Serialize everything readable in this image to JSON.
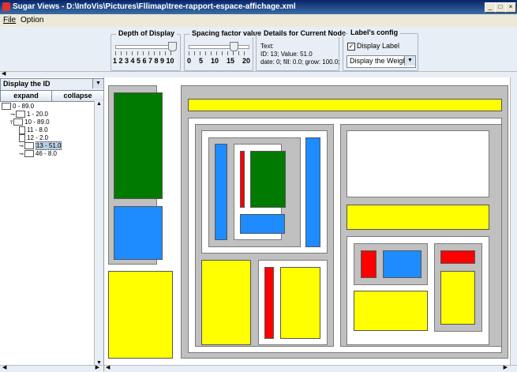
{
  "window": {
    "title": "Sugar Views - D:\\InfoVis\\Pictures\\Fllimap\\tree-rapport-espace-affichage.xml",
    "min": "_",
    "max": "□",
    "close": "×"
  },
  "menu": {
    "items": [
      {
        "label": "File"
      },
      {
        "label": "Option"
      }
    ]
  },
  "controls": {
    "depth": {
      "legend": "Depth of Display",
      "numbers": "1 2 3 4 5 6 7 8 9 10",
      "value": 10
    },
    "spacing": {
      "legend": "Spacing factor value",
      "numbers": "0    5    10    15    20",
      "value": 15
    },
    "details": {
      "legend": "Details for Current Node",
      "text": "Text:\nID: 13; Value: 51.0\ndate: 0; fill: 0.0; grow: 100.0;"
    },
    "label_config": {
      "legend": "Label's config",
      "checkbox_label": "Display Label",
      "checked": true,
      "combo_value": "Display the Weight"
    }
  },
  "sidebar": {
    "combo_value": "Display the ID",
    "expand_label": "expand",
    "collapse_label": "collapse",
    "tree": [
      {
        "label": "0 - 89.0",
        "depth": 0,
        "type": "folder"
      },
      {
        "label": "1 - 20.0",
        "depth": 1,
        "type": "folder"
      },
      {
        "label": "10 - 89.0",
        "depth": 1,
        "type": "folder"
      },
      {
        "label": "11 - 8.0",
        "depth": 2,
        "type": "doc"
      },
      {
        "label": "12 - 2.0",
        "depth": 2,
        "type": "doc"
      },
      {
        "label": "13 - 51.0",
        "depth": 2,
        "type": "folder",
        "selected": true
      },
      {
        "label": "46 - 8.0",
        "depth": 2,
        "type": "folder"
      }
    ]
  },
  "colors": {
    "green": "#007a00",
    "blue": "#1e8cff",
    "yellow": "#ffff00",
    "red": "#ff0000",
    "gray": "#c0c0c0",
    "white": "#ffffff"
  }
}
